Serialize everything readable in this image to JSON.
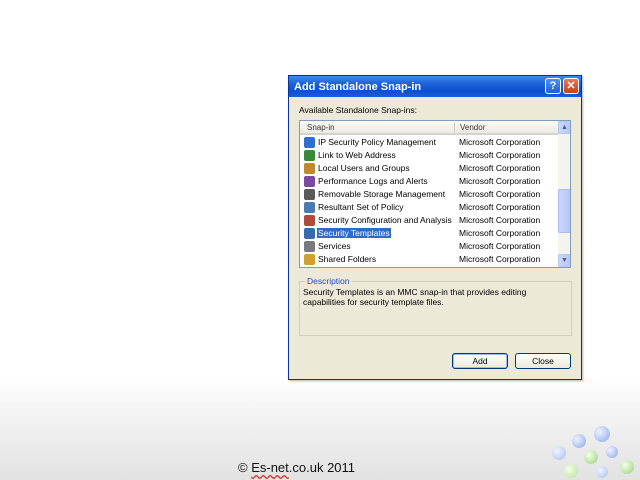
{
  "dialog": {
    "title": "Add Standalone Snap-in",
    "help_glyph": "?",
    "close_glyph": "✕",
    "available_label": "Available Standalone Snap-ins:",
    "columns": {
      "snapin": "Snap-in",
      "vendor": "Vendor"
    },
    "rows": [
      {
        "name": "IP Security Policy Management",
        "vendor": "Microsoft Corporation",
        "icon": "ip-security-icon",
        "color": "#2f6fd0"
      },
      {
        "name": "Link to Web Address",
        "vendor": "Microsoft Corporation",
        "icon": "web-link-icon",
        "color": "#3a8a3a"
      },
      {
        "name": "Local Users and Groups",
        "vendor": "Microsoft Corporation",
        "icon": "users-icon",
        "color": "#c08a2a"
      },
      {
        "name": "Performance Logs and Alerts",
        "vendor": "Microsoft Corporation",
        "icon": "performance-icon",
        "color": "#7a4aa0"
      },
      {
        "name": "Removable Storage Management",
        "vendor": "Microsoft Corporation",
        "icon": "storage-icon",
        "color": "#5a5a5a"
      },
      {
        "name": "Resultant Set of Policy",
        "vendor": "Microsoft Corporation",
        "icon": "policy-icon",
        "color": "#4a7ab0"
      },
      {
        "name": "Security Configuration and Analysis",
        "vendor": "Microsoft Corporation",
        "icon": "security-config-icon",
        "color": "#b04a3a"
      },
      {
        "name": "Security Templates",
        "vendor": "Microsoft Corporation",
        "icon": "security-templates-icon",
        "color": "#3a6ab0"
      },
      {
        "name": "Services",
        "vendor": "Microsoft Corporation",
        "icon": "services-icon",
        "color": "#7a7a7a"
      },
      {
        "name": "Shared Folders",
        "vendor": "Microsoft Corporation",
        "icon": "shared-folders-icon",
        "color": "#d0a030"
      }
    ],
    "selected_index": 7,
    "description_legend": "Description",
    "description_text": "Security Templates is an MMC snap-in that provides editing capabilities for security template files.",
    "buttons": {
      "add": "Add",
      "close": "Close"
    }
  },
  "footer": {
    "copyright": "© ",
    "site": "Es-net",
    "rest": ".co.uk 2011"
  },
  "colors": {
    "titlebar": "#0a50d0",
    "selection": "#316ac5",
    "dialog_bg": "#ece9d8"
  }
}
